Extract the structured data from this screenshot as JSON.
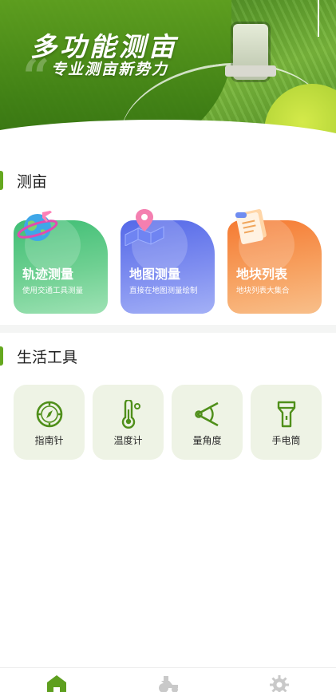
{
  "banner": {
    "title": "多功能测亩",
    "subtitle": "专业测亩新势力"
  },
  "sections": {
    "measure": "测亩",
    "tools": "生活工具"
  },
  "measure_cards": [
    {
      "title": "轨迹测量",
      "desc": "使用交通工具测量",
      "icon": "globe-plane-icon"
    },
    {
      "title": "地图测量",
      "desc": "直接在地图测量绘制",
      "icon": "map-pin-icon"
    },
    {
      "title": "地块列表",
      "desc": "地块列表大集合",
      "icon": "document-list-icon"
    }
  ],
  "tools": [
    {
      "label": "指南针",
      "icon": "compass-icon"
    },
    {
      "label": "温度计",
      "icon": "thermometer-icon"
    },
    {
      "label": "量角度",
      "icon": "protractor-icon"
    },
    {
      "label": "手电筒",
      "icon": "flashlight-icon"
    }
  ],
  "bottom_nav": [
    {
      "icon": "home-icon",
      "active": true
    },
    {
      "icon": "tractor-icon",
      "active": false
    },
    {
      "icon": "gear-icon",
      "active": false
    }
  ],
  "colors": {
    "accent": "#65a81f",
    "tool_bg": "#eef3e5",
    "card_green": "#3fbe74",
    "card_blue": "#5569e8",
    "card_orange": "#f57a32"
  }
}
